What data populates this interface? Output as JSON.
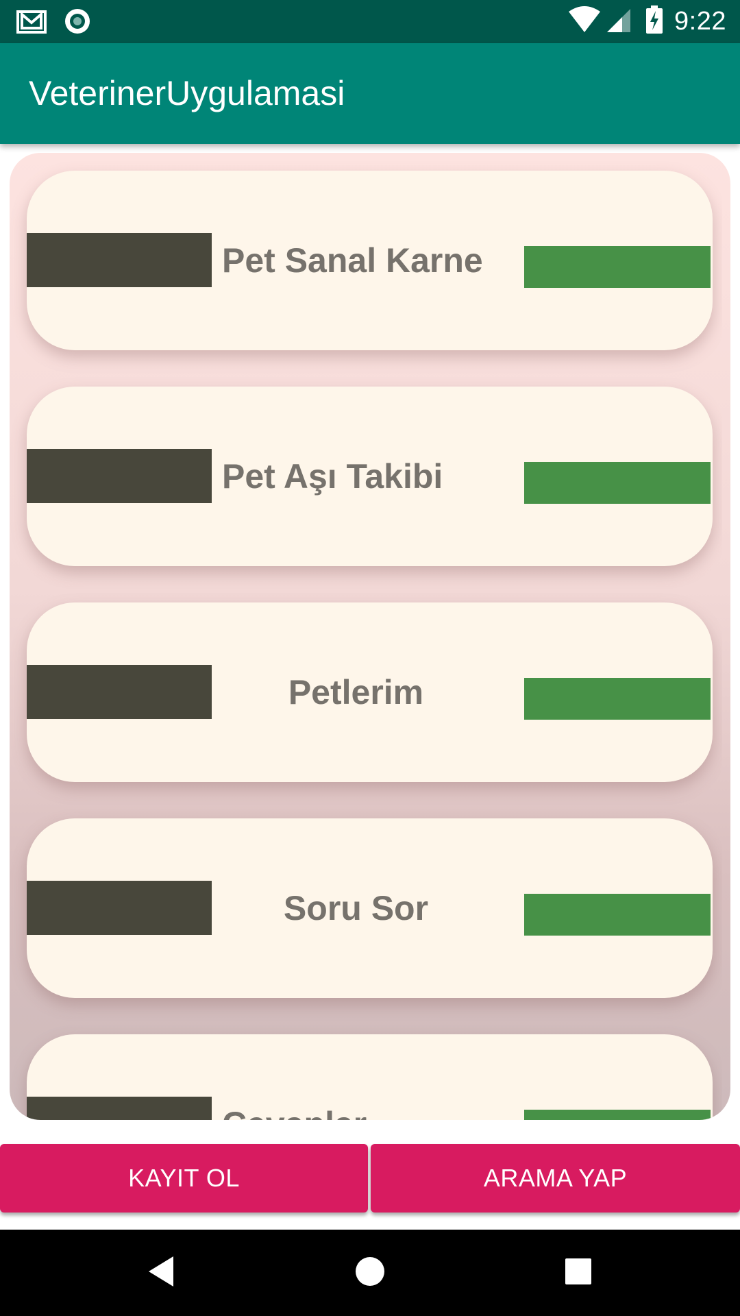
{
  "status_bar": {
    "time": "9:22",
    "left_icons": [
      "gmail-icon",
      "record-icon"
    ],
    "right_icons": [
      "wifi-icon",
      "cellular-signal-icon",
      "battery-charging-icon"
    ]
  },
  "app_bar": {
    "title": "VeterinerUygulamasi"
  },
  "menu": {
    "items": [
      {
        "label": "Pet Sanal Karne"
      },
      {
        "label": "Pet Aşı Takibi"
      },
      {
        "label": "Petlerim"
      },
      {
        "label": "Soru Sor"
      },
      {
        "label": "Cevaplar"
      }
    ]
  },
  "buttons": {
    "register_label": "KAYIT OL",
    "search_label": "ARAMA YAP"
  },
  "nav_bar": {
    "icons": [
      "back-icon",
      "home-icon",
      "recents-icon"
    ]
  },
  "colors": {
    "status_bar": "#00574B",
    "app_bar": "#008577",
    "accent": "#D81B60",
    "card_bg": "#FEF6EA",
    "card_text": "#76726C",
    "left_block": "#48473B",
    "right_block": "#479147"
  }
}
